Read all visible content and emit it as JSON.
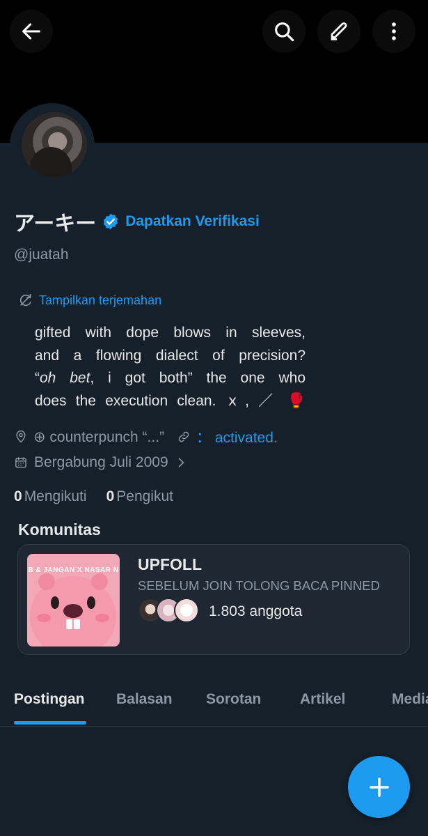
{
  "header": {
    "back_icon": "arrow-left-icon",
    "search_icon": "search-icon",
    "edit_icon": "pencil-icon",
    "more_icon": "more-vertical-icon"
  },
  "profile": {
    "name": "アーキー",
    "verified_badge_icon": "verified-badge-icon",
    "verify_link": "Dapatkan Verifikasi",
    "handle": "@juatah",
    "translate_label": "Tampilkan terjemahan",
    "bio": {
      "line1": "gifted with dope blows in sleeves,",
      "line2": "and a flowing dialect of precision?",
      "line3_prefix": "“",
      "line3_italic": "oh bet",
      "line3_rest": ", i got both”  the one who",
      "line4": "does the execution clean. ｘ, ／ 🥊"
    },
    "location_icon": "location-pin-icon",
    "location_text": "⊕ counterpunch “...”",
    "link_icon": "link-icon",
    "link_text": "：  activated.",
    "calendar_icon": "calendar-icon",
    "joined": "Bergabung Juli 2009",
    "following_count": "0",
    "following_label": "Mengikuti",
    "followers_count": "0",
    "followers_label": "Pengikut"
  },
  "communities": {
    "title": "Komunitas",
    "card": {
      "name": "UPFOLL",
      "description": "SEBELUM JOIN TOLONG BACA PINNED",
      "image_text": "B & JANGAN X NASAR N",
      "members": "1.803 anggota"
    }
  },
  "tabs": [
    {
      "label": "Postingan",
      "active": true
    },
    {
      "label": "Balasan",
      "active": false
    },
    {
      "label": "Sorotan",
      "active": false
    },
    {
      "label": "Artikel",
      "active": false
    },
    {
      "label": "Media",
      "active": false
    }
  ],
  "fab_icon": "plus-icon",
  "colors": {
    "background": "#15202b",
    "accent": "#1d9bf0",
    "secondary_text": "#8b98a5"
  }
}
